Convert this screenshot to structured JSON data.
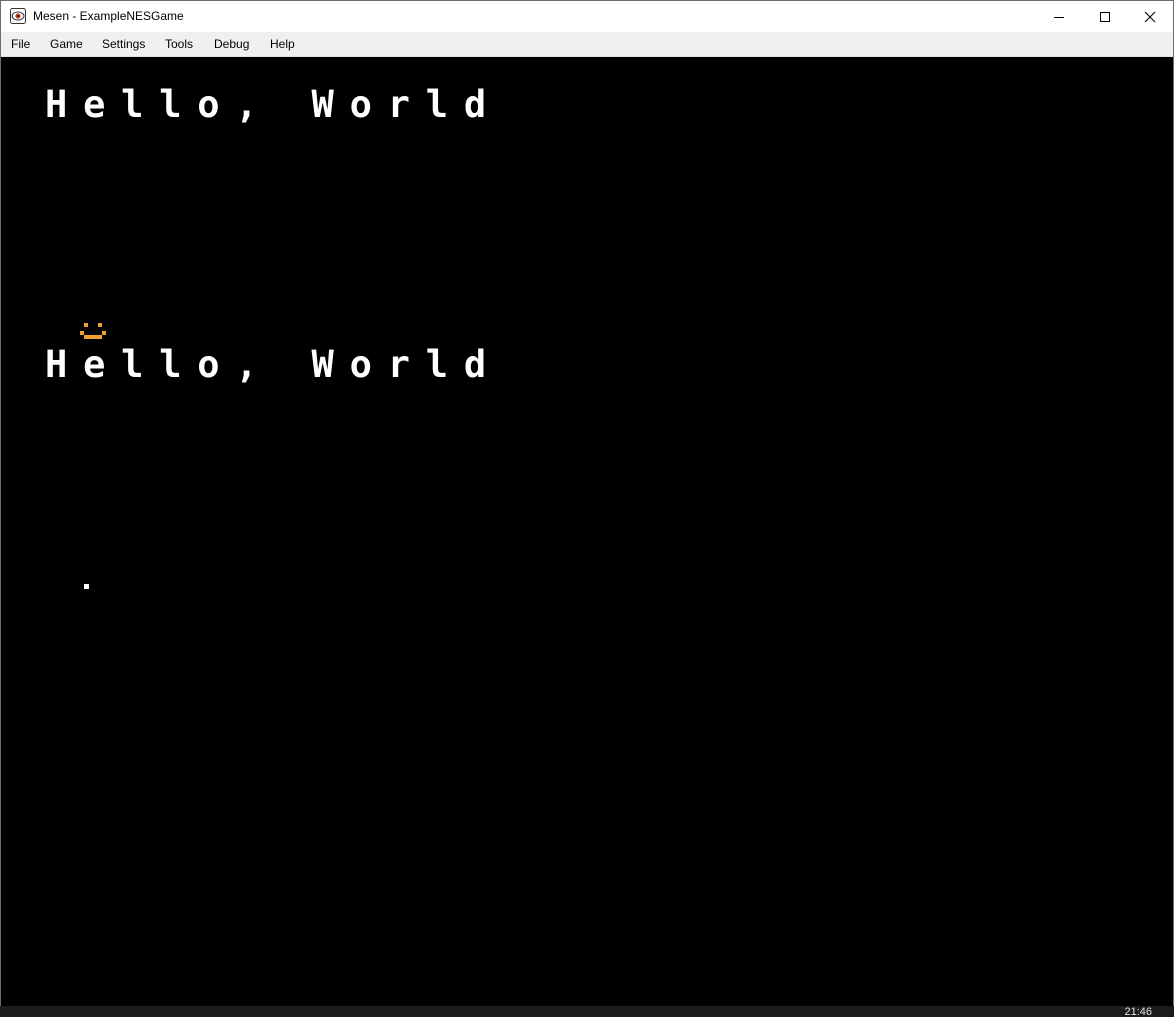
{
  "window": {
    "title": "Mesen - ExampleNESGame",
    "controls": {
      "minimize_icon": "minimize-icon",
      "maximize_icon": "maximize-icon",
      "close_icon": "close-icon"
    }
  },
  "menu": {
    "items": [
      {
        "label": "File"
      },
      {
        "label": "Game"
      },
      {
        "label": "Settings"
      },
      {
        "label": "Tools"
      },
      {
        "label": "Debug"
      },
      {
        "label": "Help"
      }
    ]
  },
  "game": {
    "line1": "Hello, World",
    "line2": "Hello, World",
    "sprite_icon": "smiley-sprite-icon",
    "sprite_color": "#f0a030",
    "text_color": "#ffffff",
    "background_color": "#000000"
  },
  "taskbar": {
    "clock": "21:46"
  }
}
